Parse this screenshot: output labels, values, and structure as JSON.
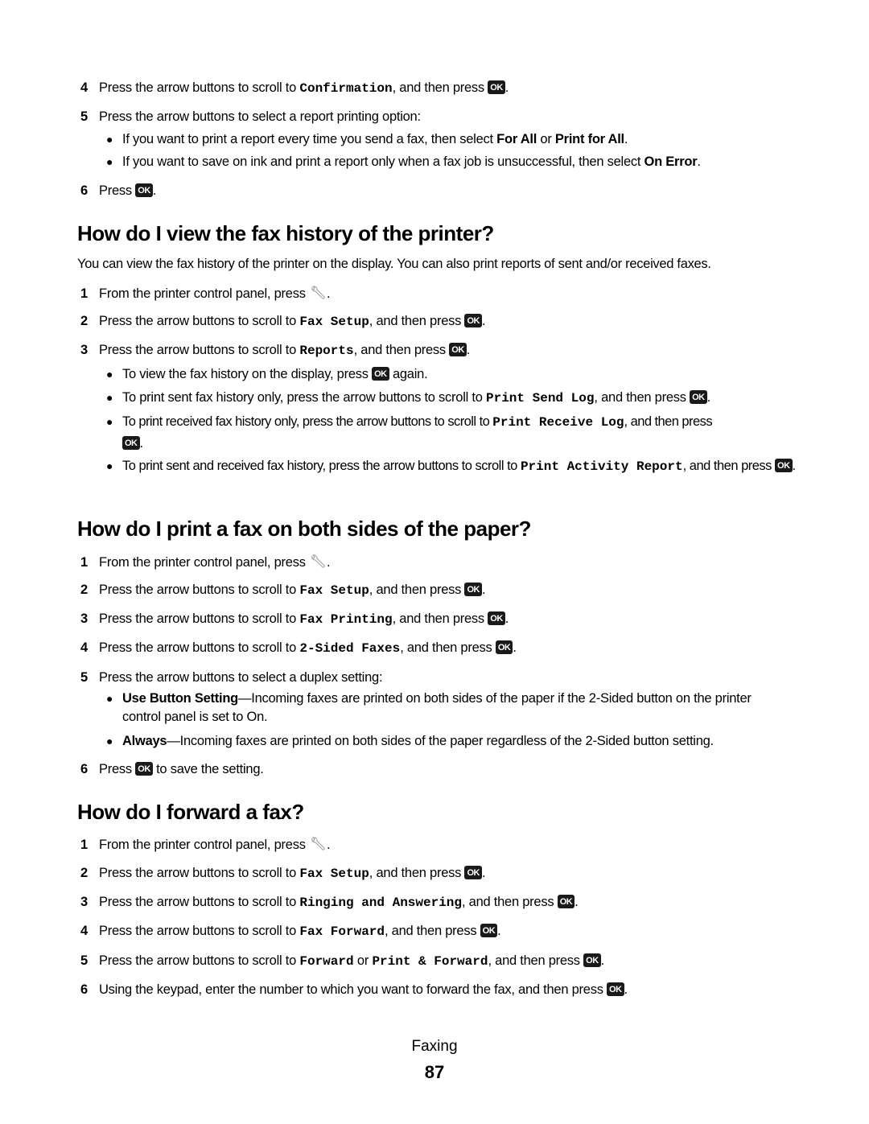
{
  "top_steps": {
    "s4": {
      "num": "4",
      "a": "Press the arrow buttons to scroll to ",
      "code": "Confirmation",
      "b": ", and then press ",
      "end": "."
    },
    "s5": {
      "num": "5",
      "text": "Press the arrow buttons to select a report printing option:"
    },
    "b1": {
      "a": "If you want to print a report every time you send a fax, then select ",
      "bold1": "For All",
      "mid": " or ",
      "bold2": "Print for All",
      "end": "."
    },
    "b2": {
      "a": "If you want to save on ink and print a report only when a fax job is unsuccessful, then select ",
      "bold1": "On Error",
      "end": "."
    },
    "s6": {
      "num": "6",
      "a": "Press ",
      "end": "."
    }
  },
  "ok_label": "OK",
  "section1": {
    "title": "How do I view the fax history of the printer?",
    "intro": "You can view the fax history of the printer on the display. You can also print reports of sent and/or received faxes.",
    "s1": {
      "num": "1",
      "a": "From the printer control panel, press ",
      "end": "."
    },
    "s2": {
      "num": "2",
      "a": "Press the arrow buttons to scroll to ",
      "code": "Fax Setup",
      "b": ", and then press ",
      "end": "."
    },
    "s3": {
      "num": "3",
      "a": "Press the arrow buttons to scroll to ",
      "code": "Reports",
      "b": ", and then press ",
      "end": "."
    },
    "b1": {
      "a": "To view the fax history on the display, press ",
      "b": " again."
    },
    "b2": {
      "a": "To print sent fax history only, press the arrow buttons to scroll to ",
      "code": "Print Send Log",
      "b": ", and then press ",
      "end": "."
    },
    "b3": {
      "a": "To print received fax history only, press the arrow buttons to scroll to ",
      "code": "Print Receive Log",
      "b": ", and then press",
      "end": "."
    },
    "b4": {
      "a": "To print sent and received fax history, press the arrow buttons to scroll to ",
      "code": "Print Activity Report",
      "b": ", and then press ",
      "end": "."
    }
  },
  "section2": {
    "title": "How do I print a fax on both sides of the paper?",
    "s1": {
      "num": "1",
      "a": "From the printer control panel, press ",
      "end": "."
    },
    "s2": {
      "num": "2",
      "a": "Press the arrow buttons to scroll to ",
      "code": "Fax Setup",
      "b": ", and then press ",
      "end": "."
    },
    "s3": {
      "num": "3",
      "a": "Press the arrow buttons to scroll to ",
      "code": "Fax Printing",
      "b": ", and then press ",
      "end": "."
    },
    "s4": {
      "num": "4",
      "a": "Press the arrow buttons to scroll to ",
      "code": "2-Sided Faxes",
      "b": ", and then press ",
      "end": "."
    },
    "s5": {
      "num": "5",
      "text": "Press the arrow buttons to select a duplex setting:"
    },
    "b1": {
      "bold": "Use Button Setting",
      "text": "—Incoming faxes are printed on both sides of the paper if the 2-Sided button on the printer control panel is set to On."
    },
    "b2": {
      "bold": "Always",
      "text": "—Incoming faxes are printed on both sides of the paper regardless of the 2-Sided button setting."
    },
    "s6": {
      "num": "6",
      "a": "Press ",
      "b": " to save the setting."
    }
  },
  "section3": {
    "title": "How do I forward a fax?",
    "s1": {
      "num": "1",
      "a": "From the printer control panel, press ",
      "end": "."
    },
    "s2": {
      "num": "2",
      "a": "Press the arrow buttons to scroll to ",
      "code": "Fax Setup",
      "b": ", and then press ",
      "end": "."
    },
    "s3": {
      "num": "3",
      "a": "Press the arrow buttons to scroll to ",
      "code": "Ringing and Answering",
      "b": ", and then press ",
      "end": "."
    },
    "s4": {
      "num": "4",
      "a": "Press the arrow buttons to scroll to ",
      "code": "Fax Forward",
      "b": ", and then press ",
      "end": "."
    },
    "s5": {
      "num": "5",
      "a": "Press the arrow buttons to scroll to ",
      "code": "Forward",
      "mid": " or ",
      "code2": "Print & Forward",
      "b": ", and then press ",
      "end": "."
    },
    "s6": {
      "num": "6",
      "a": "Using the keypad, enter the number to which you want to forward the fax, and then press ",
      "end": "."
    }
  },
  "footer": {
    "section": "Faxing",
    "page": "87"
  }
}
